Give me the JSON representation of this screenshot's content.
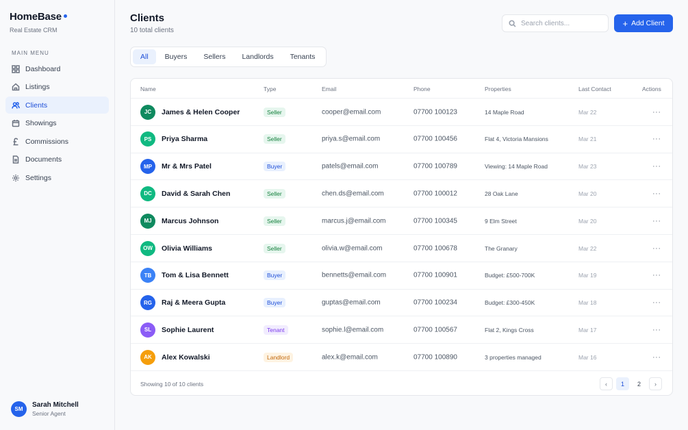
{
  "brand": {
    "name": "HomeBase",
    "subtitle": "Real Estate CRM"
  },
  "sidebar": {
    "section_label": "MAIN MENU",
    "items": [
      {
        "label": "Dashboard",
        "icon": "grid-icon"
      },
      {
        "label": "Listings",
        "icon": "home-icon"
      },
      {
        "label": "Clients",
        "icon": "users-icon",
        "active": true
      },
      {
        "label": "Showings",
        "icon": "calendar-icon"
      },
      {
        "label": "Commissions",
        "icon": "pound-icon"
      },
      {
        "label": "Documents",
        "icon": "document-icon"
      },
      {
        "label": "Settings",
        "icon": "gear-icon"
      }
    ]
  },
  "user": {
    "initials": "SM",
    "name": "Sarah Mitchell",
    "role": "Senior Agent"
  },
  "header": {
    "title": "Clients",
    "subtitle": "10 total clients",
    "search_placeholder": "Search clients...",
    "add_label": "Add Client"
  },
  "tabs": [
    "All",
    "Buyers",
    "Sellers",
    "Landlords",
    "Tenants"
  ],
  "table": {
    "columns": [
      "Name",
      "Type",
      "Email",
      "Phone",
      "Properties",
      "Last Contact",
      "Actions"
    ],
    "rows": [
      {
        "initials": "JC",
        "avatar_color": "#0f8a5f",
        "name": "James & Helen Cooper",
        "type": "Seller",
        "email": "cooper@email.com",
        "phone": "07700 100123",
        "properties": "14 Maple Road",
        "last_contact": "Mar 22"
      },
      {
        "initials": "PS",
        "avatar_color": "#10b981",
        "name": "Priya Sharma",
        "type": "Seller",
        "email": "priya.s@email.com",
        "phone": "07700 100456",
        "properties": "Flat 4, Victoria Mansions",
        "last_contact": "Mar 21"
      },
      {
        "initials": "MP",
        "avatar_color": "#2563eb",
        "name": "Mr & Mrs Patel",
        "type": "Buyer",
        "email": "patels@email.com",
        "phone": "07700 100789",
        "properties": "Viewing: 14 Maple Road",
        "last_contact": "Mar 23"
      },
      {
        "initials": "DC",
        "avatar_color": "#10b981",
        "name": "David & Sarah Chen",
        "type": "Seller",
        "email": "chen.ds@email.com",
        "phone": "07700 100012",
        "properties": "28 Oak Lane",
        "last_contact": "Mar 20"
      },
      {
        "initials": "MJ",
        "avatar_color": "#0f8a5f",
        "name": "Marcus Johnson",
        "type": "Seller",
        "email": "marcus.j@email.com",
        "phone": "07700 100345",
        "properties": "9 Elm Street",
        "last_contact": "Mar 20"
      },
      {
        "initials": "OW",
        "avatar_color": "#10b981",
        "name": "Olivia Williams",
        "type": "Seller",
        "email": "olivia.w@email.com",
        "phone": "07700 100678",
        "properties": "The Granary",
        "last_contact": "Mar 22"
      },
      {
        "initials": "TB",
        "avatar_color": "#3b82f6",
        "name": "Tom & Lisa Bennett",
        "type": "Buyer",
        "email": "bennetts@email.com",
        "phone": "07700 100901",
        "properties": "Budget: £500-700K",
        "last_contact": "Mar 19"
      },
      {
        "initials": "RG",
        "avatar_color": "#2563eb",
        "name": "Raj & Meera Gupta",
        "type": "Buyer",
        "email": "guptas@email.com",
        "phone": "07700 100234",
        "properties": "Budget: £300-450K",
        "last_contact": "Mar 18"
      },
      {
        "initials": "SL",
        "avatar_color": "#8b5cf6",
        "name": "Sophie Laurent",
        "type": "Tenant",
        "email": "sophie.l@email.com",
        "phone": "07700 100567",
        "properties": "Flat 2, Kings Cross",
        "last_contact": "Mar 17"
      },
      {
        "initials": "AK",
        "avatar_color": "#f59e0b",
        "name": "Alex Kowalski",
        "type": "Landlord",
        "email": "alex.k@email.com",
        "phone": "07700 100890",
        "properties": "3 properties managed",
        "last_contact": "Mar 16"
      }
    ],
    "actions_glyph": "···"
  },
  "badge_colors": {
    "Seller": {
      "bg": "#e6f6ee",
      "fg": "#15803d"
    },
    "Buyer": {
      "bg": "#e8f0fe",
      "fg": "#1d4ed8"
    },
    "Tenant": {
      "bg": "#f1ecfe",
      "fg": "#7c3aed"
    },
    "Landlord": {
      "bg": "#fef3e2",
      "fg": "#c2670a"
    }
  },
  "footer": {
    "summary": "Showing 10 of 10 clients",
    "pages": [
      "1",
      "2"
    ],
    "current_page": "1",
    "prev_glyph": "‹",
    "next_glyph": "›"
  }
}
